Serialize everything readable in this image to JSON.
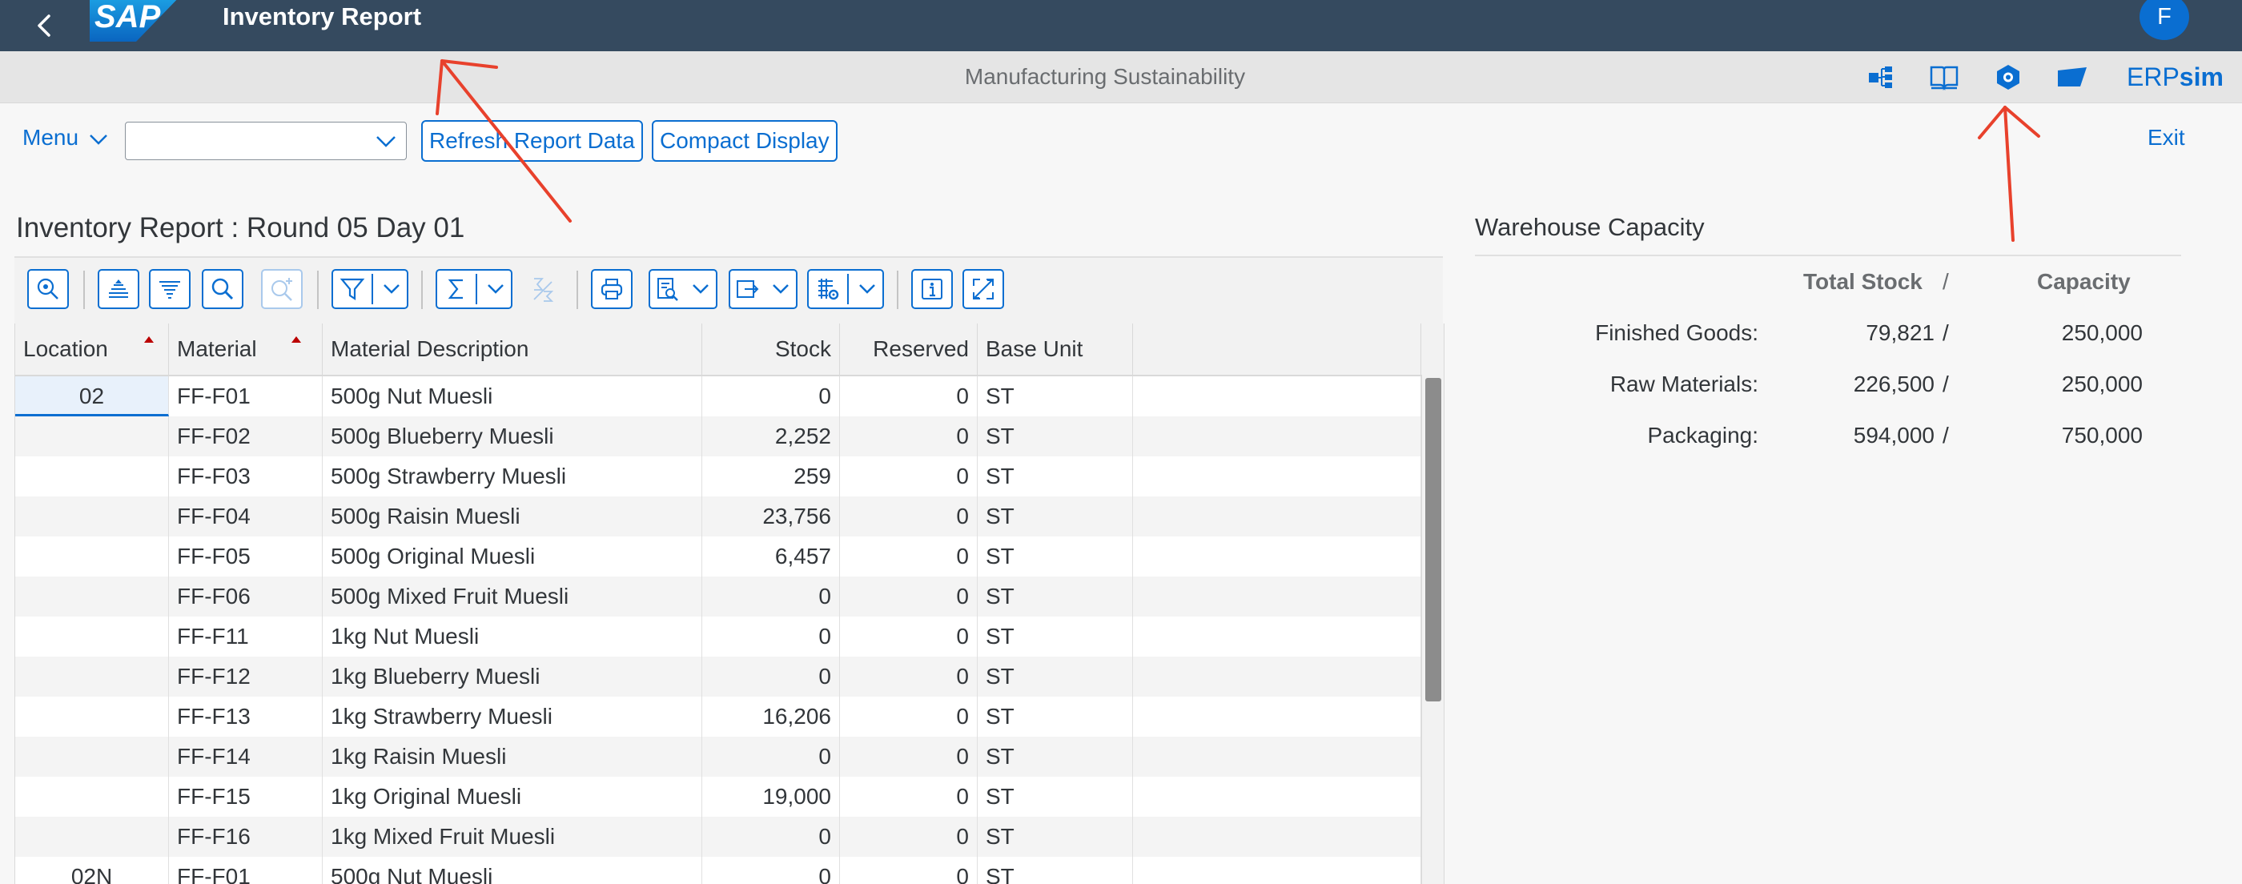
{
  "shell": {
    "title": "Inventory Report",
    "user_initial": "F",
    "logo_text": "SAP"
  },
  "subheader": {
    "center_title": "Manufacturing Sustainability",
    "brand_a": "ERP",
    "brand_b": "sim",
    "icons": [
      "process-flow-icon",
      "document-book-icon",
      "hexagon-settings-icon",
      "flag-icon"
    ]
  },
  "toolbar": {
    "menu_label": "Menu",
    "select_value": "",
    "refresh_label": "Refresh Report Data",
    "compact_label": "Compact Display",
    "exit_label": "Exit"
  },
  "report": {
    "title": "Inventory Report : Round 05 Day 01",
    "table_icons": [
      "zoom-icon",
      "align-top-icon",
      "filter-list-icon",
      "search-icon",
      "zoom-add-icon",
      "filter-icon",
      "sum-icon",
      "subtotal-icon",
      "print-icon",
      "print-preview-icon",
      "export-icon",
      "settings-grid-icon",
      "info-icon",
      "fullscreen-icon"
    ],
    "columns": [
      "Location",
      "Material",
      "Material Description",
      "Stock",
      "Reserved",
      "Base Unit"
    ],
    "rows": [
      {
        "location": "02",
        "material": "FF-F01",
        "desc": "500g Nut Muesli",
        "stock": "0",
        "reserved": "0",
        "unit": "ST"
      },
      {
        "location": "",
        "material": "FF-F02",
        "desc": "500g Blueberry Muesli",
        "stock": "2,252",
        "reserved": "0",
        "unit": "ST"
      },
      {
        "location": "",
        "material": "FF-F03",
        "desc": "500g Strawberry Muesli",
        "stock": "259",
        "reserved": "0",
        "unit": "ST"
      },
      {
        "location": "",
        "material": "FF-F04",
        "desc": "500g Raisin Muesli",
        "stock": "23,756",
        "reserved": "0",
        "unit": "ST"
      },
      {
        "location": "",
        "material": "FF-F05",
        "desc": "500g Original Muesli",
        "stock": "6,457",
        "reserved": "0",
        "unit": "ST"
      },
      {
        "location": "",
        "material": "FF-F06",
        "desc": "500g Mixed Fruit Muesli",
        "stock": "0",
        "reserved": "0",
        "unit": "ST"
      },
      {
        "location": "",
        "material": "FF-F11",
        "desc": "1kg Nut Muesli",
        "stock": "0",
        "reserved": "0",
        "unit": "ST"
      },
      {
        "location": "",
        "material": "FF-F12",
        "desc": "1kg Blueberry Muesli",
        "stock": "0",
        "reserved": "0",
        "unit": "ST"
      },
      {
        "location": "",
        "material": "FF-F13",
        "desc": "1kg Strawberry Muesli",
        "stock": "16,206",
        "reserved": "0",
        "unit": "ST"
      },
      {
        "location": "",
        "material": "FF-F14",
        "desc": "1kg Raisin Muesli",
        "stock": "0",
        "reserved": "0",
        "unit": "ST"
      },
      {
        "location": "",
        "material": "FF-F15",
        "desc": "1kg Original Muesli",
        "stock": "19,000",
        "reserved": "0",
        "unit": "ST"
      },
      {
        "location": "",
        "material": "FF-F16",
        "desc": "1kg Mixed Fruit Muesli",
        "stock": "0",
        "reserved": "0",
        "unit": "ST"
      },
      {
        "location": "02N",
        "material": "FF-F01",
        "desc": "500g Nut Muesli",
        "stock": "0",
        "reserved": "0",
        "unit": "ST"
      }
    ]
  },
  "warehouse": {
    "title": "Warehouse Capacity",
    "col_total": "Total Stock",
    "col_sep": "/",
    "col_capacity": "Capacity",
    "rows": [
      {
        "label": "Finished Goods:",
        "total": "79,821",
        "sep": "/",
        "capacity": "250,000"
      },
      {
        "label": "Raw Materials:",
        "total": "226,500",
        "sep": "/",
        "capacity": "250,000"
      },
      {
        "label": "Packaging:",
        "total": "594,000",
        "sep": "/",
        "capacity": "750,000"
      }
    ]
  },
  "colors": {
    "shell_bg": "#354a5f",
    "accent": "#0a6ed1",
    "annotation": "#e8412c"
  }
}
